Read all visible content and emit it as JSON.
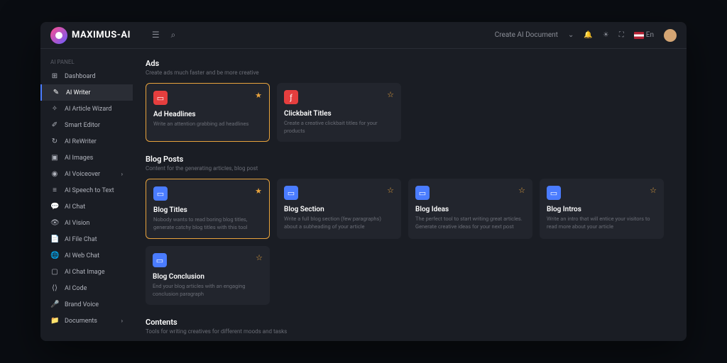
{
  "header": {
    "logo": "MAXIMUS-AI",
    "create_doc": "Create AI Document",
    "lang": "En"
  },
  "sidebar": {
    "section": "AI Panel",
    "items": [
      {
        "icon": "⊞",
        "label": "Dashboard",
        "active": false
      },
      {
        "icon": "✎",
        "label": "AI Writer",
        "active": true
      },
      {
        "icon": "✧",
        "label": "AI Article Wizard",
        "active": false
      },
      {
        "icon": "✐",
        "label": "Smart Editor",
        "active": false
      },
      {
        "icon": "↻",
        "label": "AI ReWriter",
        "active": false
      },
      {
        "icon": "▣",
        "label": "AI Images",
        "active": false
      },
      {
        "icon": "◉",
        "label": "AI Voiceover",
        "active": false,
        "chev": true
      },
      {
        "icon": "≡",
        "label": "AI Speech to Text",
        "active": false
      },
      {
        "icon": "💬",
        "label": "AI Chat",
        "active": false
      },
      {
        "icon": "👁",
        "label": "AI Vision",
        "active": false
      },
      {
        "icon": "📄",
        "label": "AI File Chat",
        "active": false
      },
      {
        "icon": "🌐",
        "label": "AI Web Chat",
        "active": false
      },
      {
        "icon": "▢",
        "label": "AI Chat Image",
        "active": false
      },
      {
        "icon": "⟨⟩",
        "label": "AI Code",
        "active": false
      },
      {
        "icon": "🎤",
        "label": "Brand Voice",
        "active": false
      },
      {
        "icon": "📁",
        "label": "Documents",
        "active": false,
        "chev": true
      }
    ]
  },
  "sections": [
    {
      "title": "Ads",
      "desc": "Create ads much faster and be more creative",
      "cards": [
        {
          "iconColor": "red",
          "iconGlyph": "▭",
          "title": "Ad Headlines",
          "desc": "Write an attention grabbing ad headlines",
          "starred": true,
          "selected": true
        },
        {
          "iconColor": "red",
          "iconGlyph": "ƒ",
          "title": "Clickbait Titles",
          "desc": "Create a creative clickbait titles for your products",
          "starred": false,
          "selected": false
        }
      ]
    },
    {
      "title": "Blog Posts",
      "desc": "Content for the generating articles, blog post",
      "cards": [
        {
          "iconColor": "blue",
          "iconGlyph": "▭",
          "title": "Blog Titles",
          "desc": "Nobody wants to read boring blog titles, generate catchy blog titles with this tool",
          "starred": true,
          "selected": true
        },
        {
          "iconColor": "blue",
          "iconGlyph": "▭",
          "title": "Blog Section",
          "desc": "Write a full blog section (few paragraphs) about a subheading of your article",
          "starred": false,
          "selected": false
        },
        {
          "iconColor": "blue",
          "iconGlyph": "▭",
          "title": "Blog Ideas",
          "desc": "The perfect tool to start writing great articles. Generate creative ideas for your next post",
          "starred": false,
          "selected": false
        },
        {
          "iconColor": "blue",
          "iconGlyph": "▭",
          "title": "Blog Intros",
          "desc": "Write an intro that will entice your visitors to read more about your article",
          "starred": false,
          "selected": false
        },
        {
          "iconColor": "blue",
          "iconGlyph": "▭",
          "title": "Blog Conclusion",
          "desc": "End your blog articles with an engaging conclusion paragraph",
          "starred": false,
          "selected": false
        }
      ]
    },
    {
      "title": "Contents",
      "desc": "Tools for writing creatives for different moods and tasks",
      "cards": []
    }
  ]
}
